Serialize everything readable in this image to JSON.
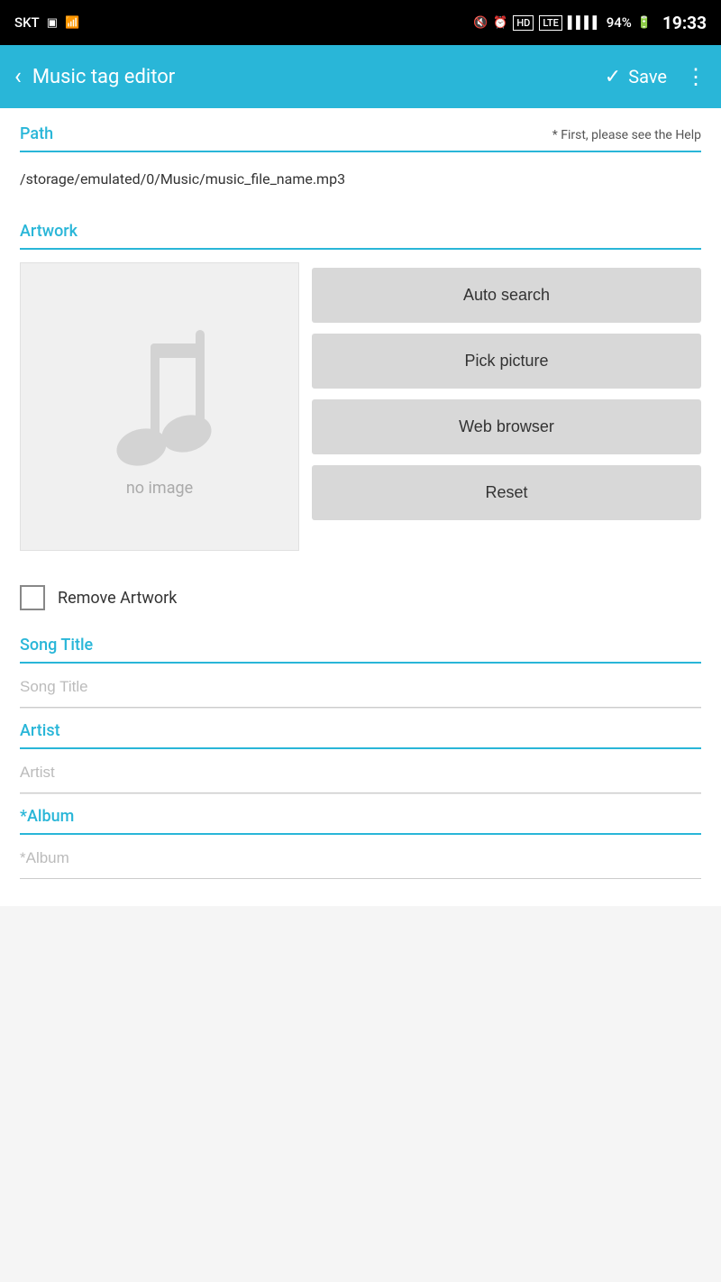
{
  "statusBar": {
    "carrier": "SKT",
    "time": "19:33",
    "battery": "94%"
  },
  "appBar": {
    "title": "Music tag editor",
    "saveLabel": "Save",
    "backIcon": "‹"
  },
  "path": {
    "label": "Path",
    "hint": "* First, please see the Help",
    "value": "/storage/emulated/0/Music/music_file_name.mp3"
  },
  "artwork": {
    "label": "Artwork",
    "noImageText": "no image",
    "buttons": {
      "autoSearch": "Auto search",
      "pickPicture": "Pick picture",
      "webBrowser": "Web browser",
      "reset": "Reset"
    },
    "removeLabel": "Remove Artwork"
  },
  "songTitle": {
    "label": "Song Title",
    "placeholder": "Song Title"
  },
  "artist": {
    "label": "Artist",
    "placeholder": "Artist"
  },
  "album": {
    "label": "*Album",
    "placeholder": "*Album"
  }
}
